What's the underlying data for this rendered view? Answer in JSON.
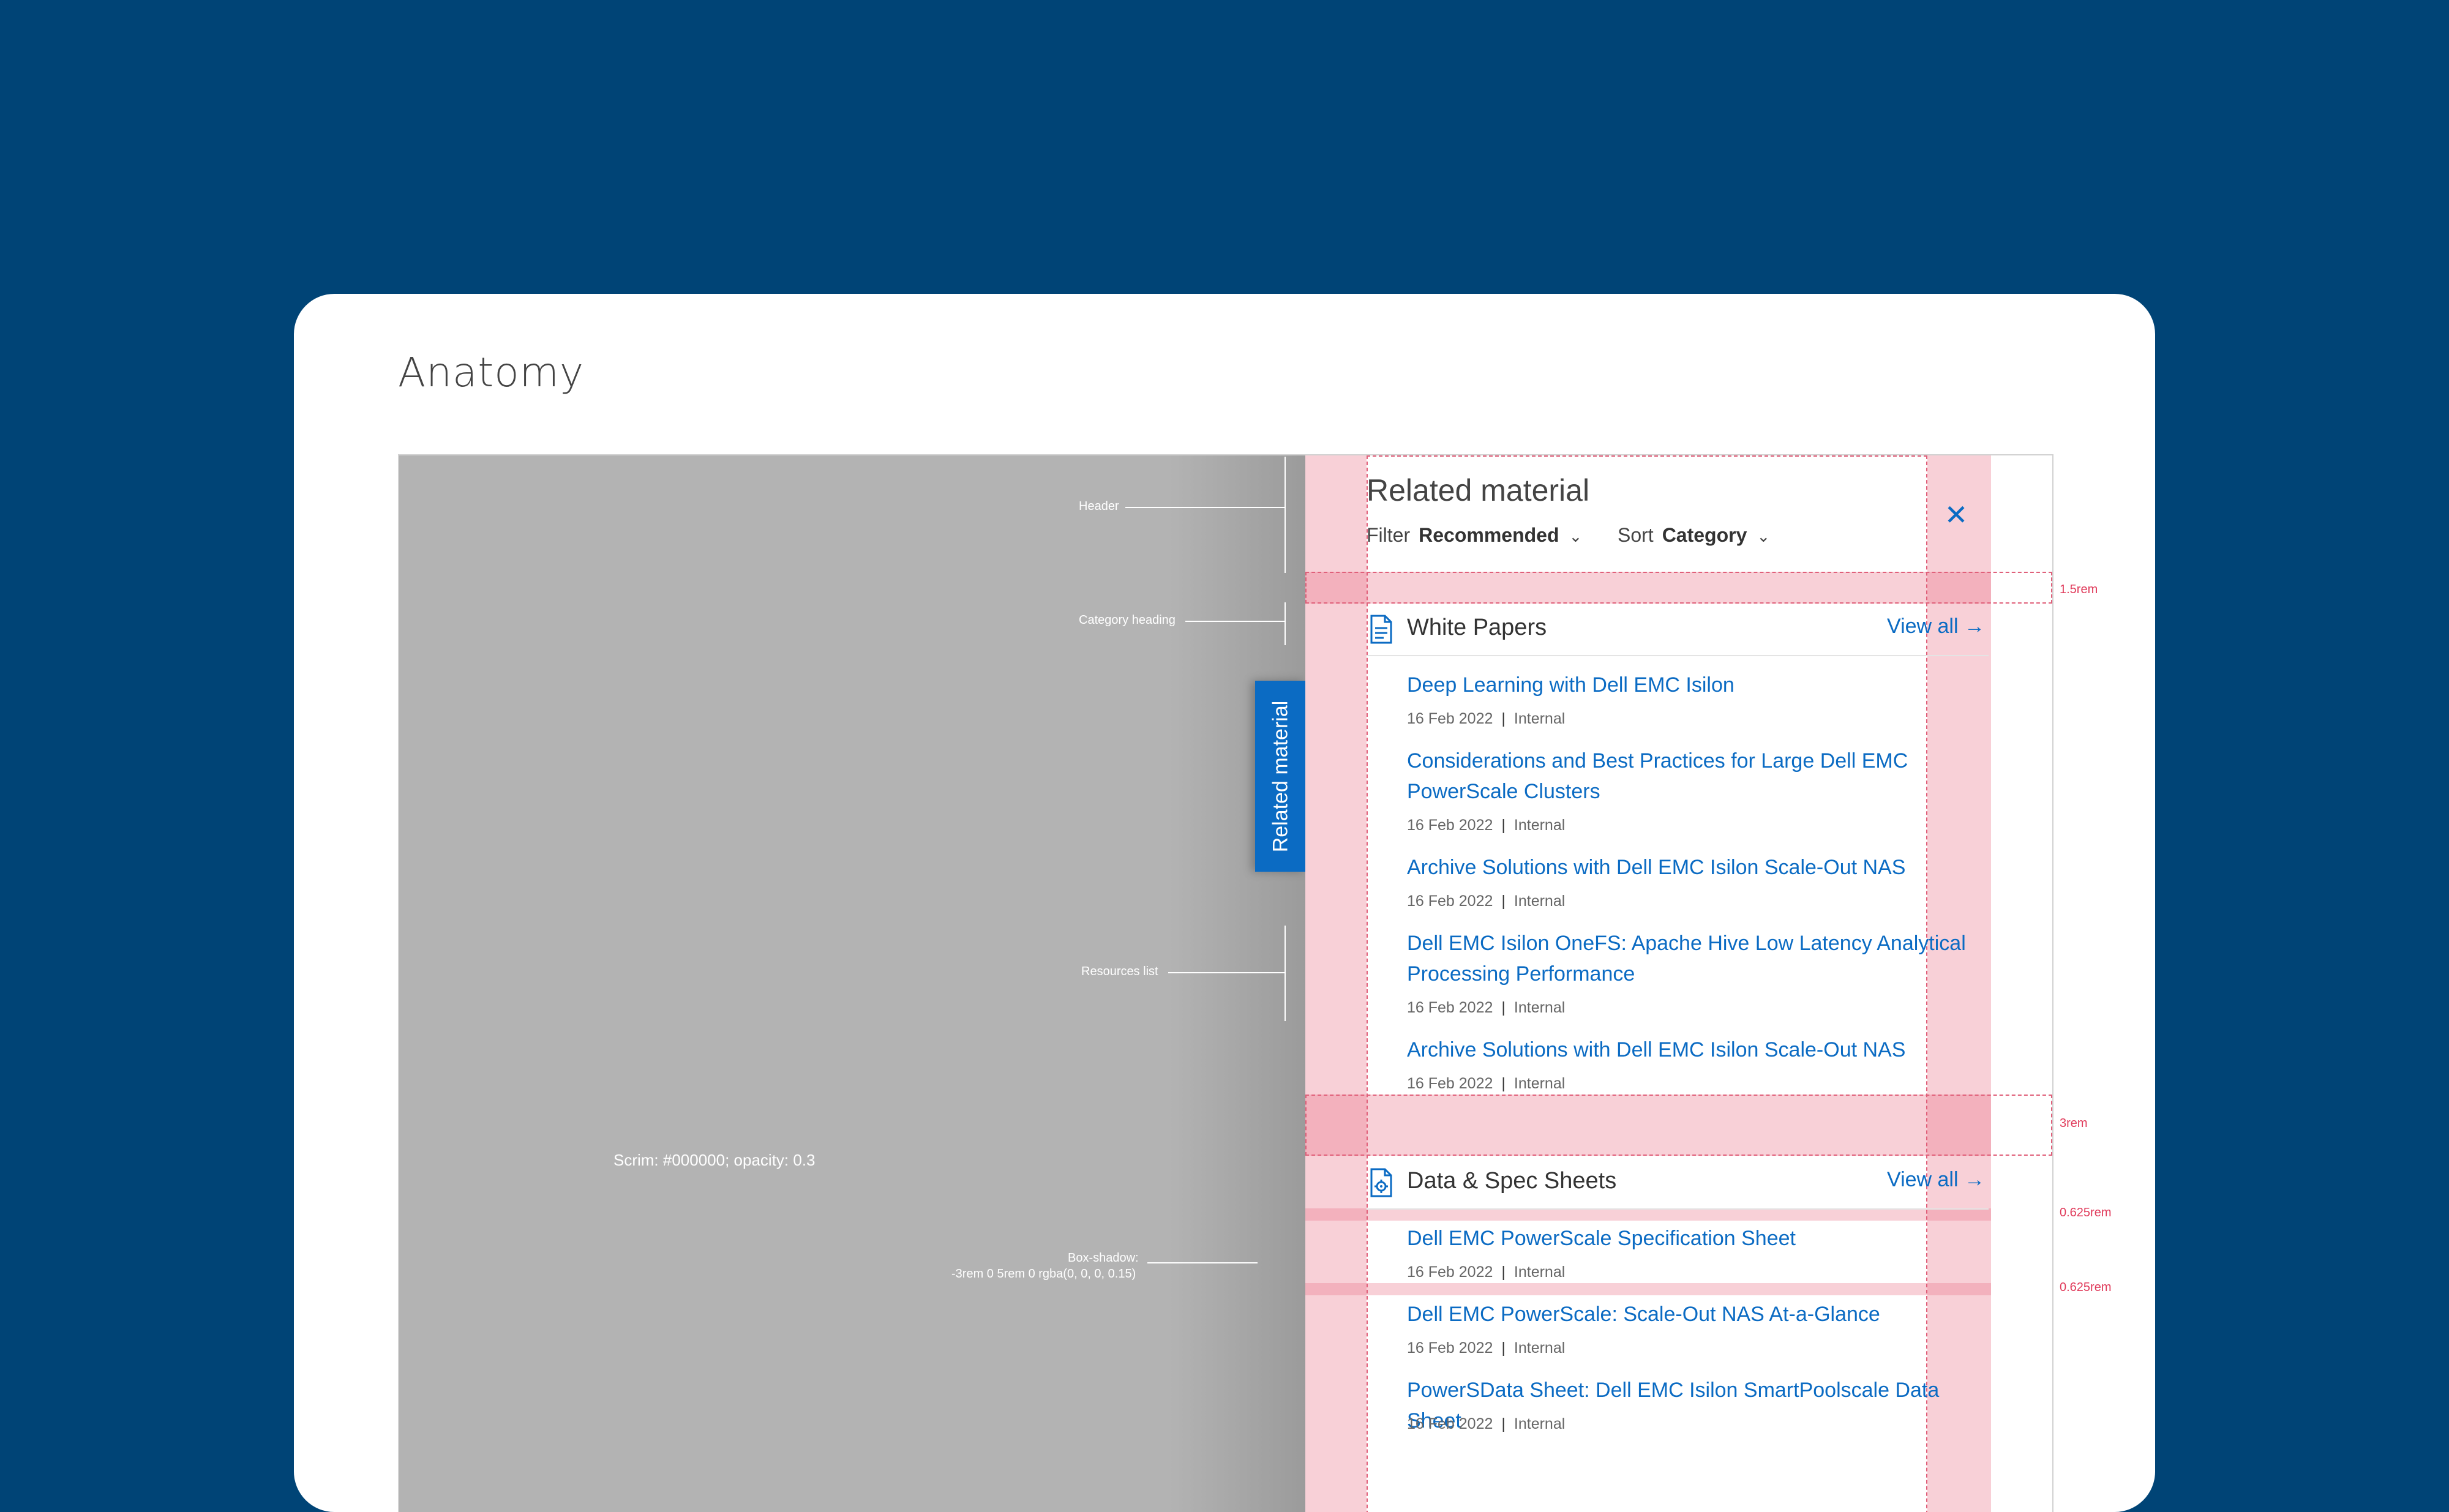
{
  "card_title": "Anatomy",
  "annotations": {
    "header": "Header",
    "category_heading": "Category heading",
    "resources_list": "Resources list",
    "scrim": "Scrim: #000000; opacity: 0.3",
    "box_shadow_line1": "Box-shadow:",
    "box_shadow_line2": "-3rem 0 5rem 0 rgba(0, 0, 0, 0.15)"
  },
  "tab_label": "Related material",
  "panel": {
    "title": "Related material",
    "filter_label": "Filter",
    "filter_value": "Recommended",
    "sort_label": "Sort",
    "sort_value": "Category",
    "categories": [
      {
        "name": "White Papers",
        "view_all": "View all",
        "icon": "document-icon",
        "items": [
          {
            "title": "Deep Learning with Dell EMC Isilon",
            "date": "16 Feb 2022",
            "tag": "Internal"
          },
          {
            "title": "Considerations and Best Practices for Large Dell EMC PowerScale Clusters",
            "date": "16 Feb 2022",
            "tag": "Internal"
          },
          {
            "title": "Archive Solutions with Dell EMC Isilon Scale-Out NAS",
            "date": "16 Feb 2022",
            "tag": "Internal"
          },
          {
            "title": "Dell EMC Isilon OneFS: Apache Hive Low Latency Analytical Processing Performance",
            "date": "16 Feb 2022",
            "tag": "Internal"
          },
          {
            "title": "Archive Solutions with Dell EMC Isilon Scale-Out NAS",
            "date": "16 Feb 2022",
            "tag": "Internal"
          }
        ]
      },
      {
        "name": "Data & Spec Sheets",
        "view_all": "View all",
        "icon": "spec-sheet-gear-icon",
        "items": [
          {
            "title": "Dell EMC PowerScale Specification Sheet",
            "date": "16 Feb 2022",
            "tag": "Internal"
          },
          {
            "title": "Dell EMC PowerScale: Scale-Out NAS At-a-Glance",
            "date": "16 Feb 2022",
            "tag": "Internal"
          },
          {
            "title": "PowerSData Sheet: Dell EMC Isilon SmartPoolscale Data Sheet",
            "date": "16 Feb 2022",
            "tag": "Internal"
          }
        ]
      }
    ]
  },
  "spacing_specs": [
    "1.5rem",
    "3rem",
    "0.625rem",
    "0.625rem"
  ],
  "colors": {
    "background": "#004476",
    "accent": "#0b6bc3",
    "spec_highlight": "#e03a5a"
  }
}
